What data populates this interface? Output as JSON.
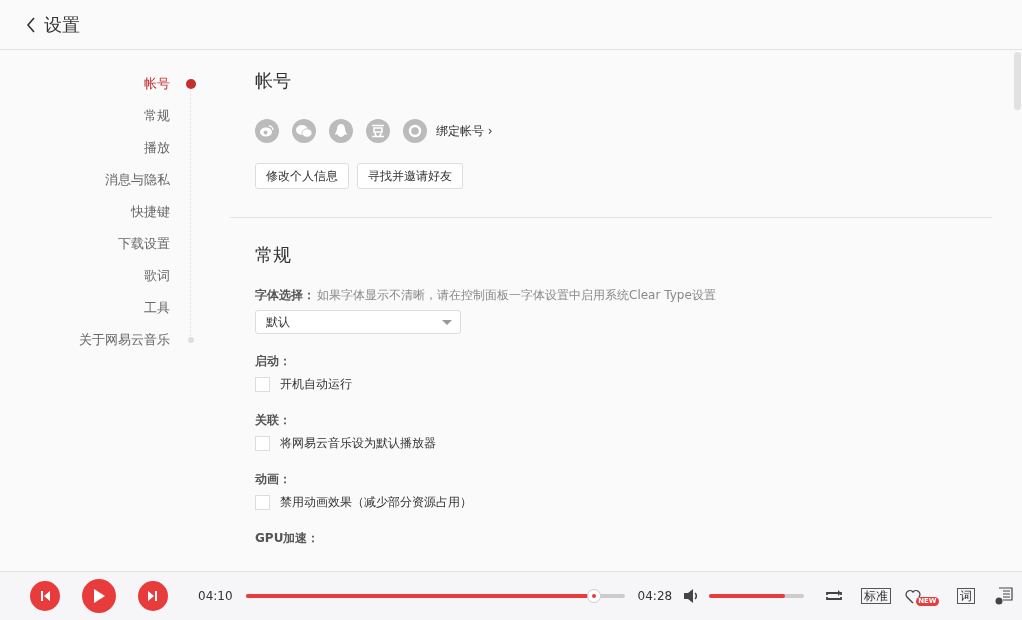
{
  "header": {
    "title": "设置"
  },
  "sidebar": {
    "items": [
      {
        "label": "帐号",
        "selected": true
      },
      {
        "label": "常规",
        "selected": false
      },
      {
        "label": "播放",
        "selected": false
      },
      {
        "label": "消息与隐私",
        "selected": false
      },
      {
        "label": "快捷键",
        "selected": false
      },
      {
        "label": "下载设置",
        "selected": false
      },
      {
        "label": "歌词",
        "selected": false
      },
      {
        "label": "工具",
        "selected": false
      },
      {
        "label": "关于网易云音乐",
        "selected": false
      }
    ]
  },
  "account": {
    "title": "帐号",
    "bind_link": "绑定帐号 ›",
    "buttons": [
      "修改个人信息",
      "寻找并邀请好友"
    ]
  },
  "general": {
    "title": "常规",
    "font": {
      "label": "字体选择：",
      "hint": "如果字体显示不清晰，请在控制面板一字体设置中启用系统Clear Type设置",
      "value": "默认"
    },
    "groups": [
      {
        "label": "启动：",
        "option": "开机自动运行",
        "checked": false
      },
      {
        "label": "关联：",
        "option": "将网易云音乐设为默认播放器",
        "checked": false
      },
      {
        "label": "动画：",
        "option": "禁用动画效果（减少部分资源占用）",
        "checked": false
      }
    ],
    "next_label": "GPU加速："
  },
  "player": {
    "elapsed": "04:10",
    "total": "04:28",
    "progress": {
      "level": 0.92
    },
    "volume": {
      "level": 0.8
    },
    "quality": "标准",
    "lyrics": "词",
    "new_badge": "NEW"
  }
}
